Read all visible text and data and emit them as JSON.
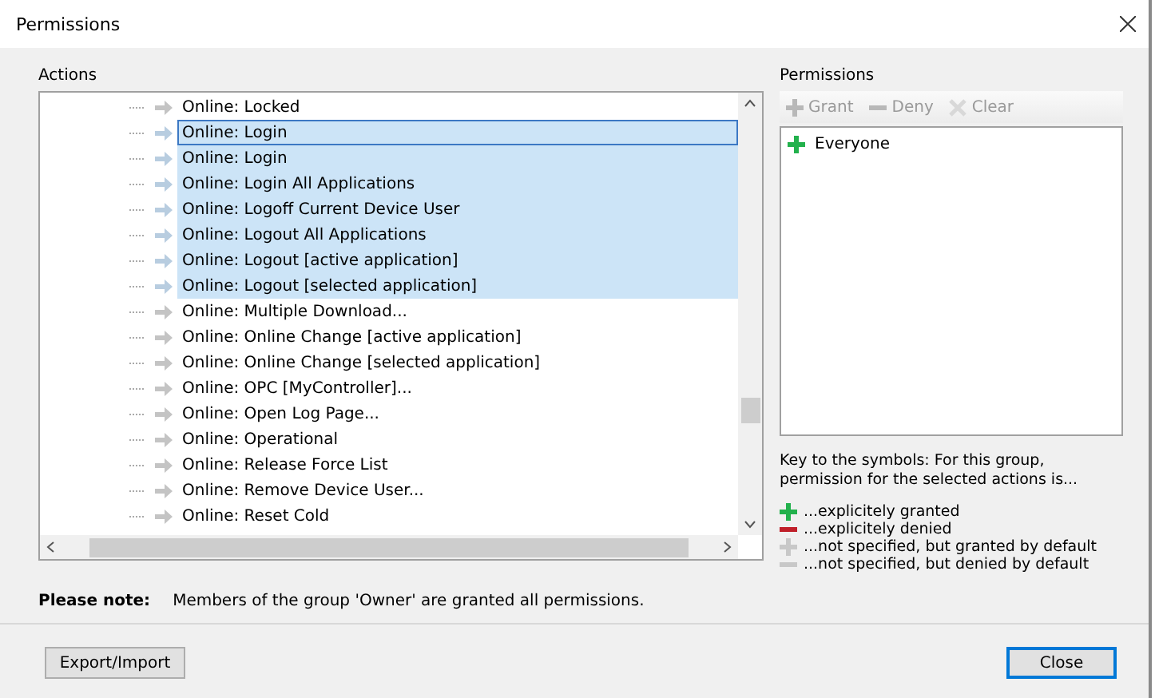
{
  "window": {
    "title": "Permissions"
  },
  "actions": {
    "label": "Actions",
    "items": [
      {
        "label": "Online: Locked",
        "selected": false,
        "focused": false
      },
      {
        "label": "Online: Login",
        "selected": true,
        "focused": true
      },
      {
        "label": "Online: Login",
        "selected": true,
        "focused": false
      },
      {
        "label": "Online: Login All Applications",
        "selected": true,
        "focused": false
      },
      {
        "label": "Online: Logoff Current Device User",
        "selected": true,
        "focused": false
      },
      {
        "label": "Online: Logout All Applications",
        "selected": true,
        "focused": false
      },
      {
        "label": "Online: Logout [active application]",
        "selected": true,
        "focused": false
      },
      {
        "label": "Online: Logout [selected application]",
        "selected": true,
        "focused": false
      },
      {
        "label": "Online: Multiple Download...",
        "selected": false,
        "focused": false
      },
      {
        "label": "Online: Online Change [active application]",
        "selected": false,
        "focused": false
      },
      {
        "label": "Online: Online Change [selected application]",
        "selected": false,
        "focused": false
      },
      {
        "label": "Online: OPC [MyController]...",
        "selected": false,
        "focused": false
      },
      {
        "label": "Online: Open Log Page...",
        "selected": false,
        "focused": false
      },
      {
        "label": "Online: Operational",
        "selected": false,
        "focused": false
      },
      {
        "label": "Online: Release Force List",
        "selected": false,
        "focused": false
      },
      {
        "label": "Online: Remove Device User...",
        "selected": false,
        "focused": false
      },
      {
        "label": "Online: Reset Cold",
        "selected": false,
        "focused": false
      }
    ]
  },
  "note": {
    "label": "Please note:",
    "text": "Members of the group 'Owner' are granted all permissions."
  },
  "permissions": {
    "label": "Permissions",
    "toolbar": [
      {
        "kind": "grant",
        "label": "Grant",
        "disabled": true
      },
      {
        "kind": "deny",
        "label": "Deny",
        "disabled": true
      },
      {
        "kind": "clear",
        "label": "Clear",
        "disabled": true
      }
    ],
    "groups": [
      {
        "kind": "granted",
        "label": "Everyone"
      }
    ],
    "key_text": "Key to the symbols: For this group, permission for the selected actions is...",
    "legend": [
      {
        "kind": "granted",
        "label": "...explicitely granted"
      },
      {
        "kind": "denied",
        "label": "...explicitely denied"
      },
      {
        "kind": "default-granted",
        "label": "...not specified, but granted by default"
      },
      {
        "kind": "default-denied",
        "label": "...not specified, but denied by default"
      }
    ]
  },
  "buttons": [
    {
      "label": "Export/Import",
      "default": false
    },
    {
      "label": "Close",
      "default": true
    }
  ]
}
